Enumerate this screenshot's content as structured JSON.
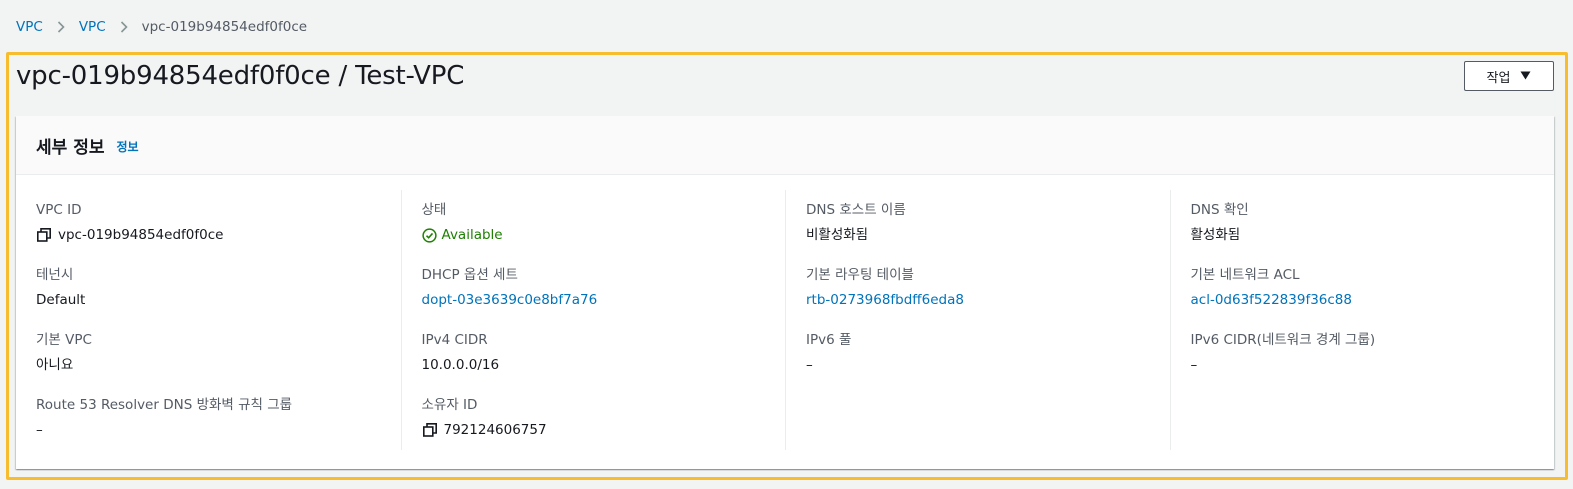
{
  "breadcrumb": {
    "items": [
      "VPC",
      "VPC"
    ],
    "current": "vpc-019b94854edf0f0ce"
  },
  "page_title": "vpc-019b94854edf0f0ce / Test-VPC",
  "actions_button": {
    "label": "작업",
    "icon": "caret-down-icon"
  },
  "panel": {
    "title": "세부 정보",
    "info_link": "정보"
  },
  "details": {
    "col1": [
      {
        "label": "VPC ID",
        "value": "vpc-019b94854edf0f0ce",
        "icon": "copy-icon"
      },
      {
        "label": "테넌시",
        "value": "Default"
      },
      {
        "label": "기본 VPC",
        "value": "아니요"
      },
      {
        "label": "Route 53 Resolver DNS 방화벽 규칙 그룹",
        "value": "–"
      }
    ],
    "col2": [
      {
        "label": "상태",
        "value": "Available",
        "icon": "check-circle-icon"
      },
      {
        "label": "DHCP 옵션 세트",
        "value": "dopt-03e3639c0e8bf7a76"
      },
      {
        "label": "IPv4 CIDR",
        "value": "10.0.0.0/16"
      },
      {
        "label": "소유자 ID",
        "value": "792124606757",
        "icon": "copy-icon"
      }
    ],
    "col3": [
      {
        "label": "DNS 호스트 이름",
        "value": "비활성화됨"
      },
      {
        "label": "기본 라우팅 테이블",
        "value": "rtb-0273968fbdff6eda8"
      },
      {
        "label": "IPv6 풀",
        "value": "–"
      }
    ],
    "col4": [
      {
        "label": "DNS 확인",
        "value": "활성화됨"
      },
      {
        "label": "기본 네트워크 ACL",
        "value": "acl-0d63f522839f36c88"
      },
      {
        "label": "IPv6 CIDR(네트워크 경계 그룹)",
        "value": "–"
      }
    ]
  },
  "colors": {
    "link": "#0073bb",
    "status_ok": "#1d8102",
    "highlight": "#f7bd2e"
  }
}
